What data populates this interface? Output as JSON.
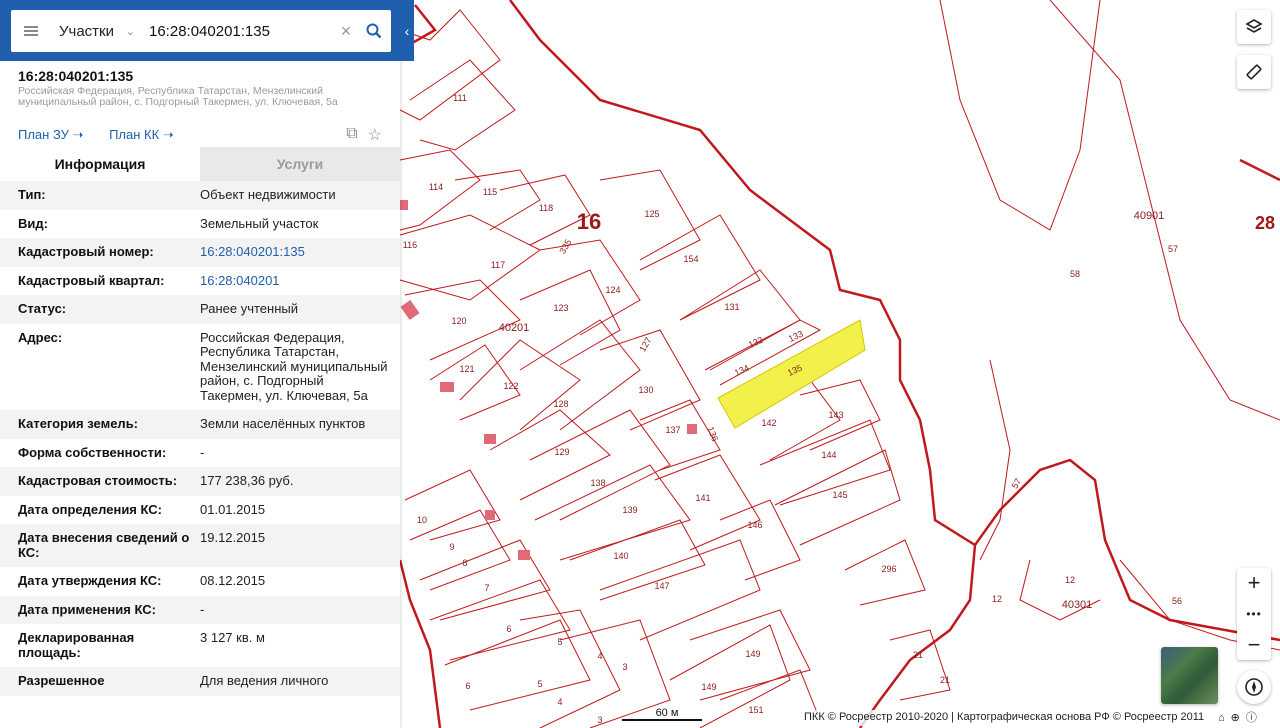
{
  "search": {
    "layer": "Участки",
    "query": "16:28:040201:135"
  },
  "object": {
    "title": "16:28:040201:135",
    "subtitle": "Российская Федерация, Республика Татарстан, Мензелинский муниципальный район, с. Подгорный Такермен, ул. Ключевая, 5а",
    "plan_zu": "План ЗУ",
    "plan_kk": "План КК"
  },
  "tabs": {
    "info": "Информация",
    "services": "Услуги"
  },
  "info": [
    {
      "key": "Тип:",
      "value": "Объект недвижимости"
    },
    {
      "key": "Вид:",
      "value": "Земельный участок"
    },
    {
      "key": "Кадастровый номер:",
      "value": "16:28:040201:135"
    },
    {
      "key": "Кадастровый квартал:",
      "value": "16:28:040201"
    },
    {
      "key": "Статус:",
      "value": "Ранее учтенный"
    },
    {
      "key": "Адрес:",
      "value": "Российская Федерация, Республика Татарстан, Мензелинский муниципальный район, с. Подгорный Такермен, ул. Ключевая, 5а"
    },
    {
      "key": "Категория земель:",
      "value": "Земли населённых пунктов"
    },
    {
      "key": "Форма собственности:",
      "value": "-"
    },
    {
      "key": "Кадастровая стоимость:",
      "value": "177 238,36 руб."
    },
    {
      "key": "Дата определения КС:",
      "value": "01.01.2015"
    },
    {
      "key": "Дата внесения сведений о КС:",
      "value": "19.12.2015"
    },
    {
      "key": "Дата утверждения КС:",
      "value": "08.12.2015"
    },
    {
      "key": "Дата применения КС:",
      "value": "-"
    },
    {
      "key": "Декларированная площадь:",
      "value": "3 127 кв. м"
    },
    {
      "key": "Разрешенное",
      "value": "Для ведения личного"
    }
  ],
  "map": {
    "zone_label": "16",
    "zone_label_2": "28",
    "block_labels": [
      "40201",
      "40901",
      "40301"
    ],
    "parcel_labels": [
      "111",
      "114",
      "115",
      "116",
      "117",
      "118",
      "335",
      "120",
      "121",
      "122",
      "123",
      "124",
      "125",
      "127",
      "128",
      "129",
      "130",
      "131",
      "132",
      "133",
      "134",
      "135",
      "136",
      "137",
      "138",
      "139",
      "140",
      "141",
      "142",
      "143",
      "144",
      "145",
      "146",
      "147",
      "149",
      "149",
      "151",
      "154",
      "296",
      "10",
      "9",
      "8",
      "7",
      "6",
      "6",
      "5",
      "5",
      "4",
      "4",
      "3",
      "3",
      "58",
      "57",
      "57",
      "12",
      "12",
      "56",
      "21",
      "21"
    ],
    "highlight_color": "#f2f04a",
    "boundary_color": "#c0181c",
    "scale": "60 м",
    "attribution": "ПКК © Росреестр 2010-2020 | Картографическая основа РФ © Росреестр 2011"
  },
  "controls": {
    "zoom_in": "+",
    "more": "•••",
    "zoom_out": "−"
  }
}
